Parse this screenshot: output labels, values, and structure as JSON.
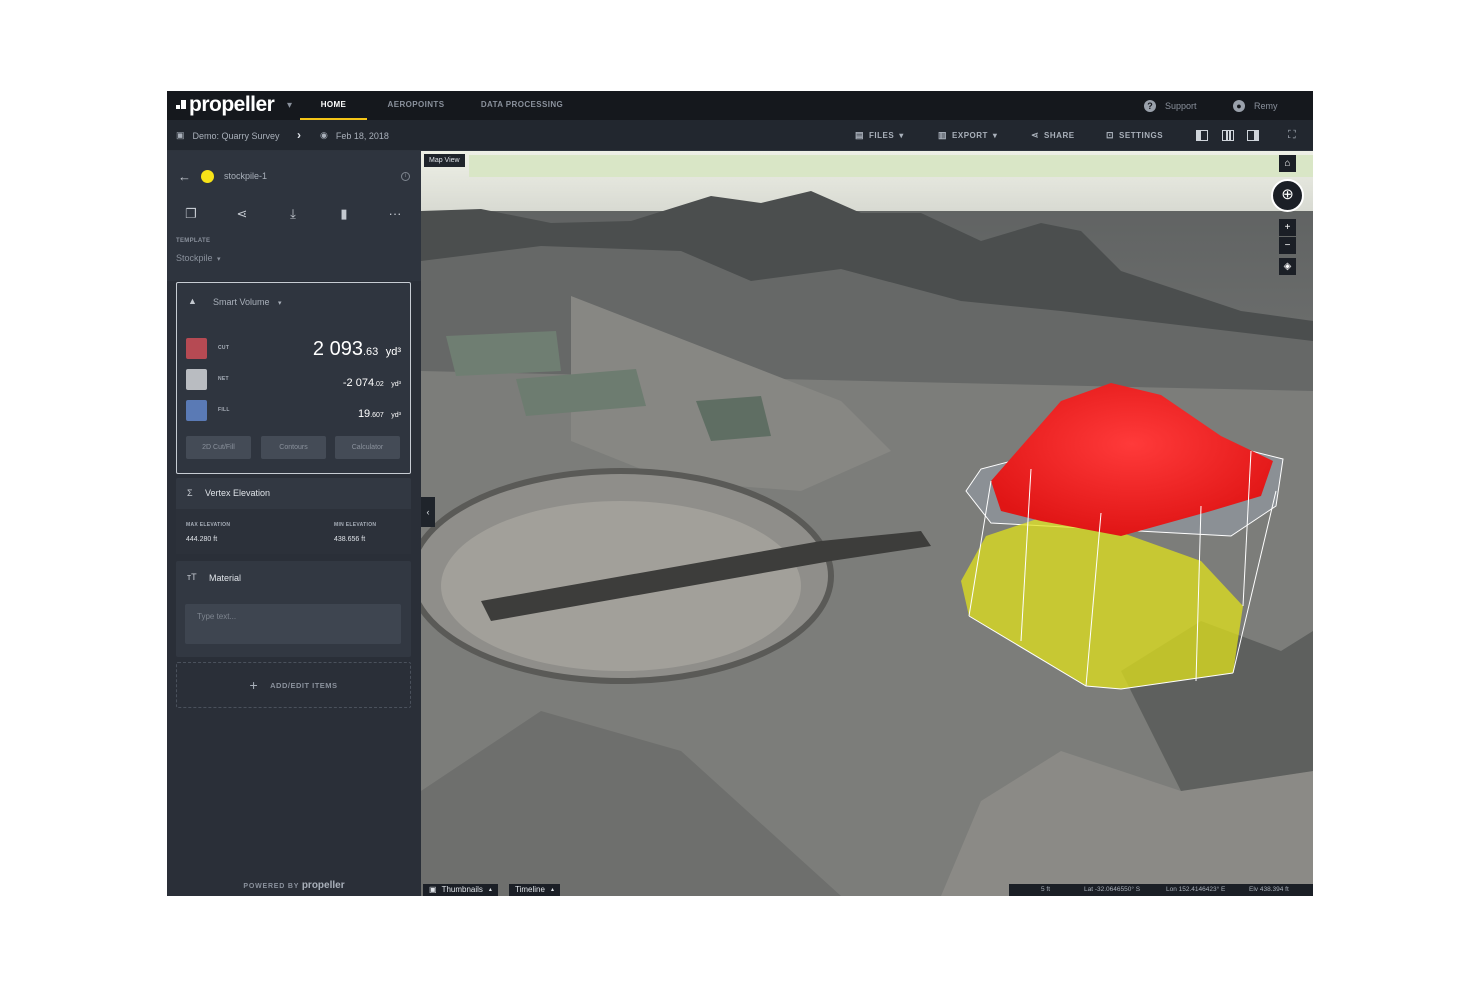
{
  "app": {
    "logo_text": "propeller",
    "nav_tabs": [
      {
        "label": "HOME",
        "active": true
      },
      {
        "label": "AEROPOINTS",
        "active": false
      },
      {
        "label": "DATA PROCESSING",
        "active": false
      }
    ],
    "support_label": "Support",
    "user_name": "Remy",
    "accent_color": "#f5c518"
  },
  "toolbar": {
    "project": "Demo: Quarry Survey",
    "survey_date": "Feb 18, 2018",
    "files_label": "FILES",
    "export_label": "EXPORT",
    "share_label": "SHARE",
    "settings_label": "SETTINGS"
  },
  "sidebar": {
    "item_name": "stockpile-1",
    "item_color": "#f7e318",
    "template_label": "TEMPLATE",
    "template_value": "Stockpile",
    "volume": {
      "title": "Smart Volume",
      "rows": [
        {
          "label": "CUT",
          "int": "2 093",
          "dec": ".63",
          "unit": "yd³",
          "color": "#b64a53"
        },
        {
          "label": "NET",
          "int": "-2 074",
          "dec": ".02",
          "unit": "yd³",
          "color": "#b9bcc1"
        },
        {
          "label": "FILL",
          "int": "19",
          "dec": ".607",
          "unit": "yd³",
          "color": "#5a7ab5"
        }
      ],
      "buttons": [
        "2D Cut/Fill",
        "Contours",
        "Calculator"
      ]
    },
    "vertex": {
      "title": "Vertex Elevation",
      "max_label": "MAX ELEVATION",
      "max_value": "444.280 ft",
      "min_label": "MIN ELEVATION",
      "min_value": "438.656 ft"
    },
    "material": {
      "title": "Material",
      "placeholder": "Type text..."
    },
    "add_items_label": "ADD/EDIT ITEMS",
    "powered_by": "POWERED BY",
    "powered_logo": "propeller"
  },
  "map": {
    "view_label": "Map View",
    "thumbnails_label": "Thumbnails",
    "timeline_label": "Timeline",
    "scale": "5 ft",
    "lat": "Lat  -32.0646550° S",
    "lon": "Lon  152.4146423° E",
    "elev": "Elv  438.394 ft",
    "cut_color": "#ff2a2a",
    "fill_color": "#e0e21c"
  }
}
